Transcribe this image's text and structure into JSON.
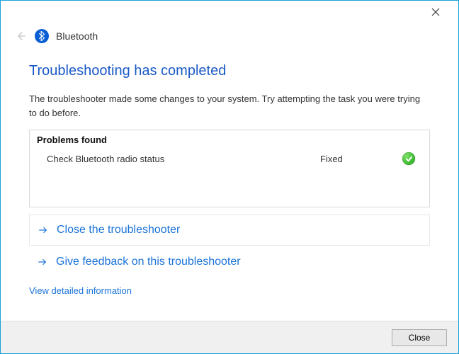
{
  "header": {
    "title": "Bluetooth"
  },
  "headline": "Troubleshooting has completed",
  "body_text": "The troubleshooter made some changes to your system. Try attempting the task you were trying to do before.",
  "problems": {
    "header": "Problems found",
    "items": [
      {
        "description": "Check Bluetooth radio status",
        "status": "Fixed"
      }
    ]
  },
  "links": {
    "close_troubleshooter": "Close the troubleshooter",
    "give_feedback": "Give feedback on this troubleshooter",
    "view_detail": "View detailed information"
  },
  "footer": {
    "close_label": "Close"
  }
}
